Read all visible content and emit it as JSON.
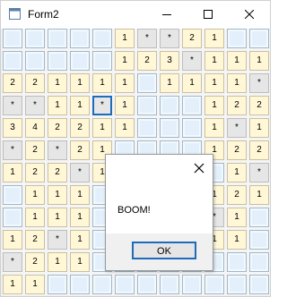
{
  "window": {
    "title": "Form2"
  },
  "grid": [
    [
      "h",
      "h",
      "h",
      "h",
      "h",
      "1",
      "*",
      "*",
      "2",
      "1",
      "h",
      "h"
    ],
    [
      "h",
      "h",
      "h",
      "h",
      "h",
      "1",
      "2",
      "3",
      "*",
      "1",
      "1",
      "1"
    ],
    [
      "2",
      "2",
      "1",
      "1",
      "1",
      "1",
      "h",
      "1",
      "1",
      "1",
      "1",
      "*"
    ],
    [
      "*",
      "*",
      "1",
      "1",
      "*",
      "1",
      "h",
      "h",
      "h",
      "1",
      "2",
      "2"
    ],
    [
      "3",
      "4",
      "2",
      "2",
      "1",
      "1",
      "h",
      "h",
      "h",
      "1",
      "*",
      "1"
    ],
    [
      "*",
      "2",
      "*",
      "2",
      "1",
      "h",
      "h",
      "h",
      "h",
      "1",
      "2",
      "2"
    ],
    [
      "1",
      "2",
      "2",
      "*",
      "1",
      "h",
      "h",
      "h",
      "h",
      "h",
      "1",
      "*"
    ],
    [
      "h",
      "1",
      "1",
      "1",
      "h",
      "h",
      "h",
      "h",
      "h",
      "1",
      "2",
      "1"
    ],
    [
      "h",
      "1",
      "1",
      "1",
      "h",
      "h",
      "h",
      "h",
      "h",
      "*",
      "1",
      "h"
    ],
    [
      "1",
      "2",
      "*",
      "1",
      "h",
      "h",
      "h",
      "h",
      "h",
      "1",
      "1",
      "h"
    ],
    [
      "*",
      "2",
      "1",
      "1",
      "h",
      "h",
      "h",
      "h",
      "h",
      "h",
      "h",
      "h"
    ],
    [
      "1",
      "1",
      "h",
      "h",
      "h",
      "h",
      "h",
      "h",
      "h",
      "h",
      "h",
      "h"
    ]
  ],
  "selected_cell": {
    "row": 3,
    "col": 4
  },
  "dialog": {
    "message": "BOOM!",
    "ok_label": "OK"
  },
  "colors": {
    "hidden": "#e3f0fb",
    "open": "#fff7d6",
    "mine": "#e6e6e6",
    "accent": "#1c6bbd"
  }
}
